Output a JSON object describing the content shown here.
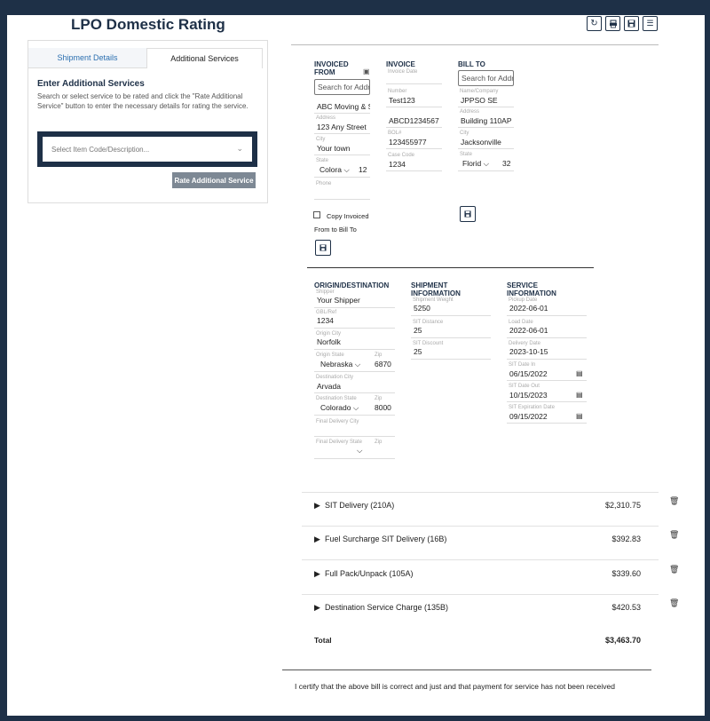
{
  "app": {
    "title": "LPO Domestic Rating",
    "toolbar_icons": [
      "refresh-icon",
      "print-icon",
      "save-icon",
      "list-icon"
    ]
  },
  "services_panel": {
    "tabs": [
      "Shipment Details",
      "Additional Services"
    ],
    "active_tab": "Additional Services",
    "heading": "Enter Additional Services",
    "description": "Search or select service to be rated and click the \"Rate Additional Service\" button to enter the necessary details for rating the service.",
    "select_placeholder": "Select Item Code/Description...",
    "rate_button": "Rate Additional Service"
  },
  "invoiced_from": {
    "heading": "INVOICED FROM",
    "search_placeholder": "Search for Addr",
    "name": "ABC Moving & S",
    "address_label": "Address",
    "address": "123 Any Street",
    "city_label": "City",
    "city": "Your town",
    "state_label": "State",
    "state": "Colora",
    "zip": "12",
    "phone_label": "Phone",
    "copy_label_1": "Copy Invoiced",
    "copy_label_2": "From to Bill To"
  },
  "invoice": {
    "heading": "INVOICE",
    "date_label": "Invoice Date",
    "number_label": "Number",
    "number": "Test123",
    "number2": "ABCD1234567",
    "bol_label": "BOL#",
    "bol": "123455977",
    "case_label": "Case Code",
    "case": "1234"
  },
  "bill_to": {
    "heading": "BILL TO",
    "search_placeholder": "Search for Addr",
    "name_label": "Name/Company",
    "name": "JPPSO SE",
    "address_label": "Address",
    "address": "Building 110AP",
    "city_label": "City",
    "city": "Jacksonville",
    "state_label": "State",
    "state": "Florid",
    "zip": "32"
  },
  "origin_destination": {
    "heading": "ORIGIN/DESTINATION",
    "shipper_label": "Shipper",
    "shipper": "Your Shipper",
    "gbl_label": "GBL/Ref",
    "gbl": "1234",
    "origin_city_label": "Origin City",
    "origin_city": "Norfolk",
    "origin_state_label": "Origin State",
    "origin_state": "Nebraska",
    "zip_label": "Zip",
    "origin_zip": "6870",
    "dest_city_label": "Destination City",
    "dest_city": "Arvada",
    "dest_state_label": "Destination State",
    "dest_state": "Colorado",
    "dest_zip": "8000",
    "final_city_label": "Final Delivery City",
    "final_state_label": "Final Delivery State",
    "final_zip_label": "Zip"
  },
  "shipment_information": {
    "heading": "SHIPMENT INFORMATION",
    "weight_label": "Shipment Weight",
    "weight": "5250",
    "sit_distance_label": "SIT Distance",
    "sit_distance": "25",
    "sit_discount_label": "SIT Discount",
    "sit_discount": "25"
  },
  "service_information": {
    "heading": "SERVICE INFORMATION",
    "pickup_label": "Pickup Date",
    "pickup": "2022-06-01",
    "load_label": "Load Date",
    "load": "2022-06-01",
    "delivery_label": "Delivery Date",
    "delivery": "2023-10-15",
    "sit_in_label": "SIT Date In",
    "sit_in": "06/15/2022",
    "sit_out_label": "SIT Date Out",
    "sit_out": "10/15/2023",
    "sit_exp_label": "SIT Expiration Date",
    "sit_exp": "09/15/2022"
  },
  "charges": [
    {
      "label": "SIT Delivery (210A)",
      "amount": "$2,310.75"
    },
    {
      "label": "Fuel Surcharge SIT Delivery (16B)",
      "amount": "$392.83"
    },
    {
      "label": "Full Pack/Unpack (105A)",
      "amount": "$339.60"
    },
    {
      "label": "Destination Service Charge (135B)",
      "amount": "$420.53"
    }
  ],
  "total": {
    "label": "Total",
    "amount": "$3,463.70"
  },
  "certification": "I certify that the above bill is correct and just and that payment for service has not been received"
}
